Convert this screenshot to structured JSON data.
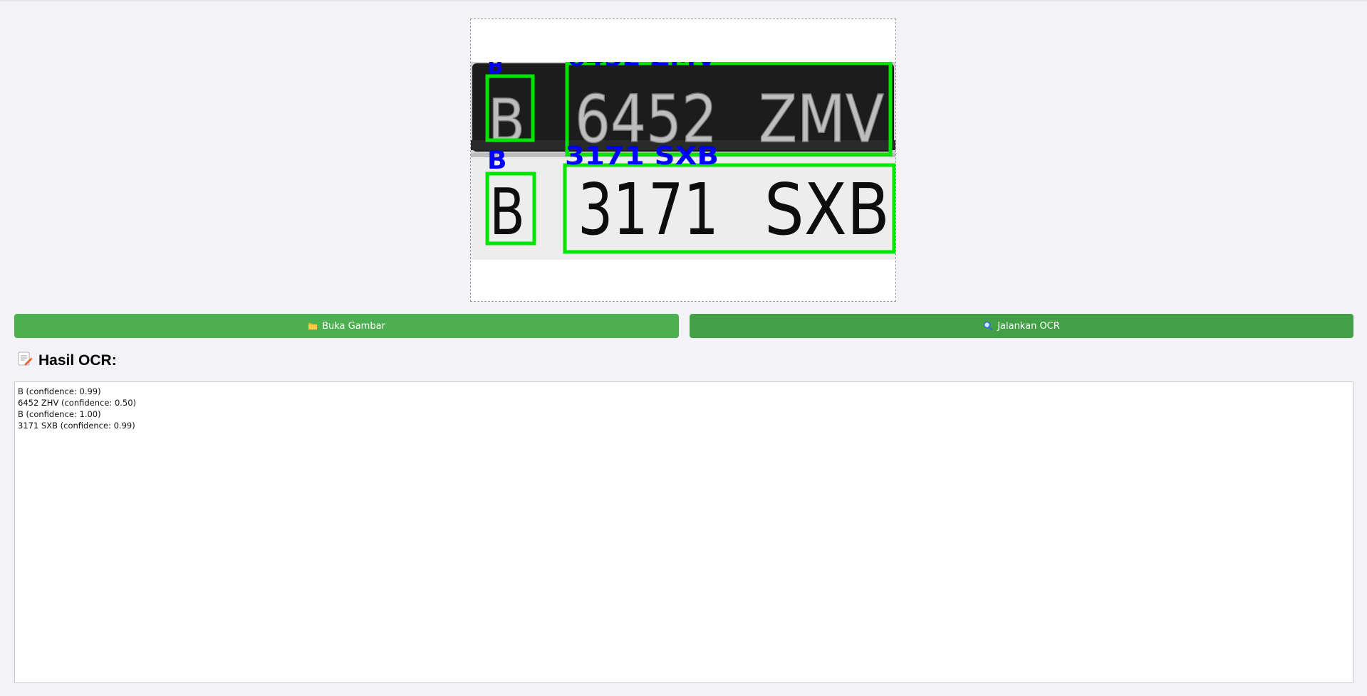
{
  "buttons": {
    "open_label": "Buka Gambar",
    "ocr_label": "Jalankan OCR",
    "open_icon": "folder-icon",
    "ocr_icon": "magnifier-icon"
  },
  "result": {
    "heading": "Hasil OCR:",
    "heading_icon": "memo-icon",
    "lines": [
      "B (confidence: 0.99)",
      "6452 ZHV (confidence: 0.50)",
      "B (confidence: 1.00)",
      "3171 SXB (confidence: 0.99)"
    ]
  },
  "image": {
    "annotations": [
      {
        "label": "B"
      },
      {
        "label": "6452 ZMV"
      },
      {
        "label": "B"
      },
      {
        "label": "3171 SXB"
      }
    ],
    "plates": [
      {
        "region": "B",
        "number": "6452",
        "suffix": "ZMV"
      },
      {
        "region": "B",
        "number": "3171",
        "suffix": "SXB"
      }
    ],
    "colors": {
      "box": "#00e600",
      "annotation_text": "#0000ff"
    }
  }
}
